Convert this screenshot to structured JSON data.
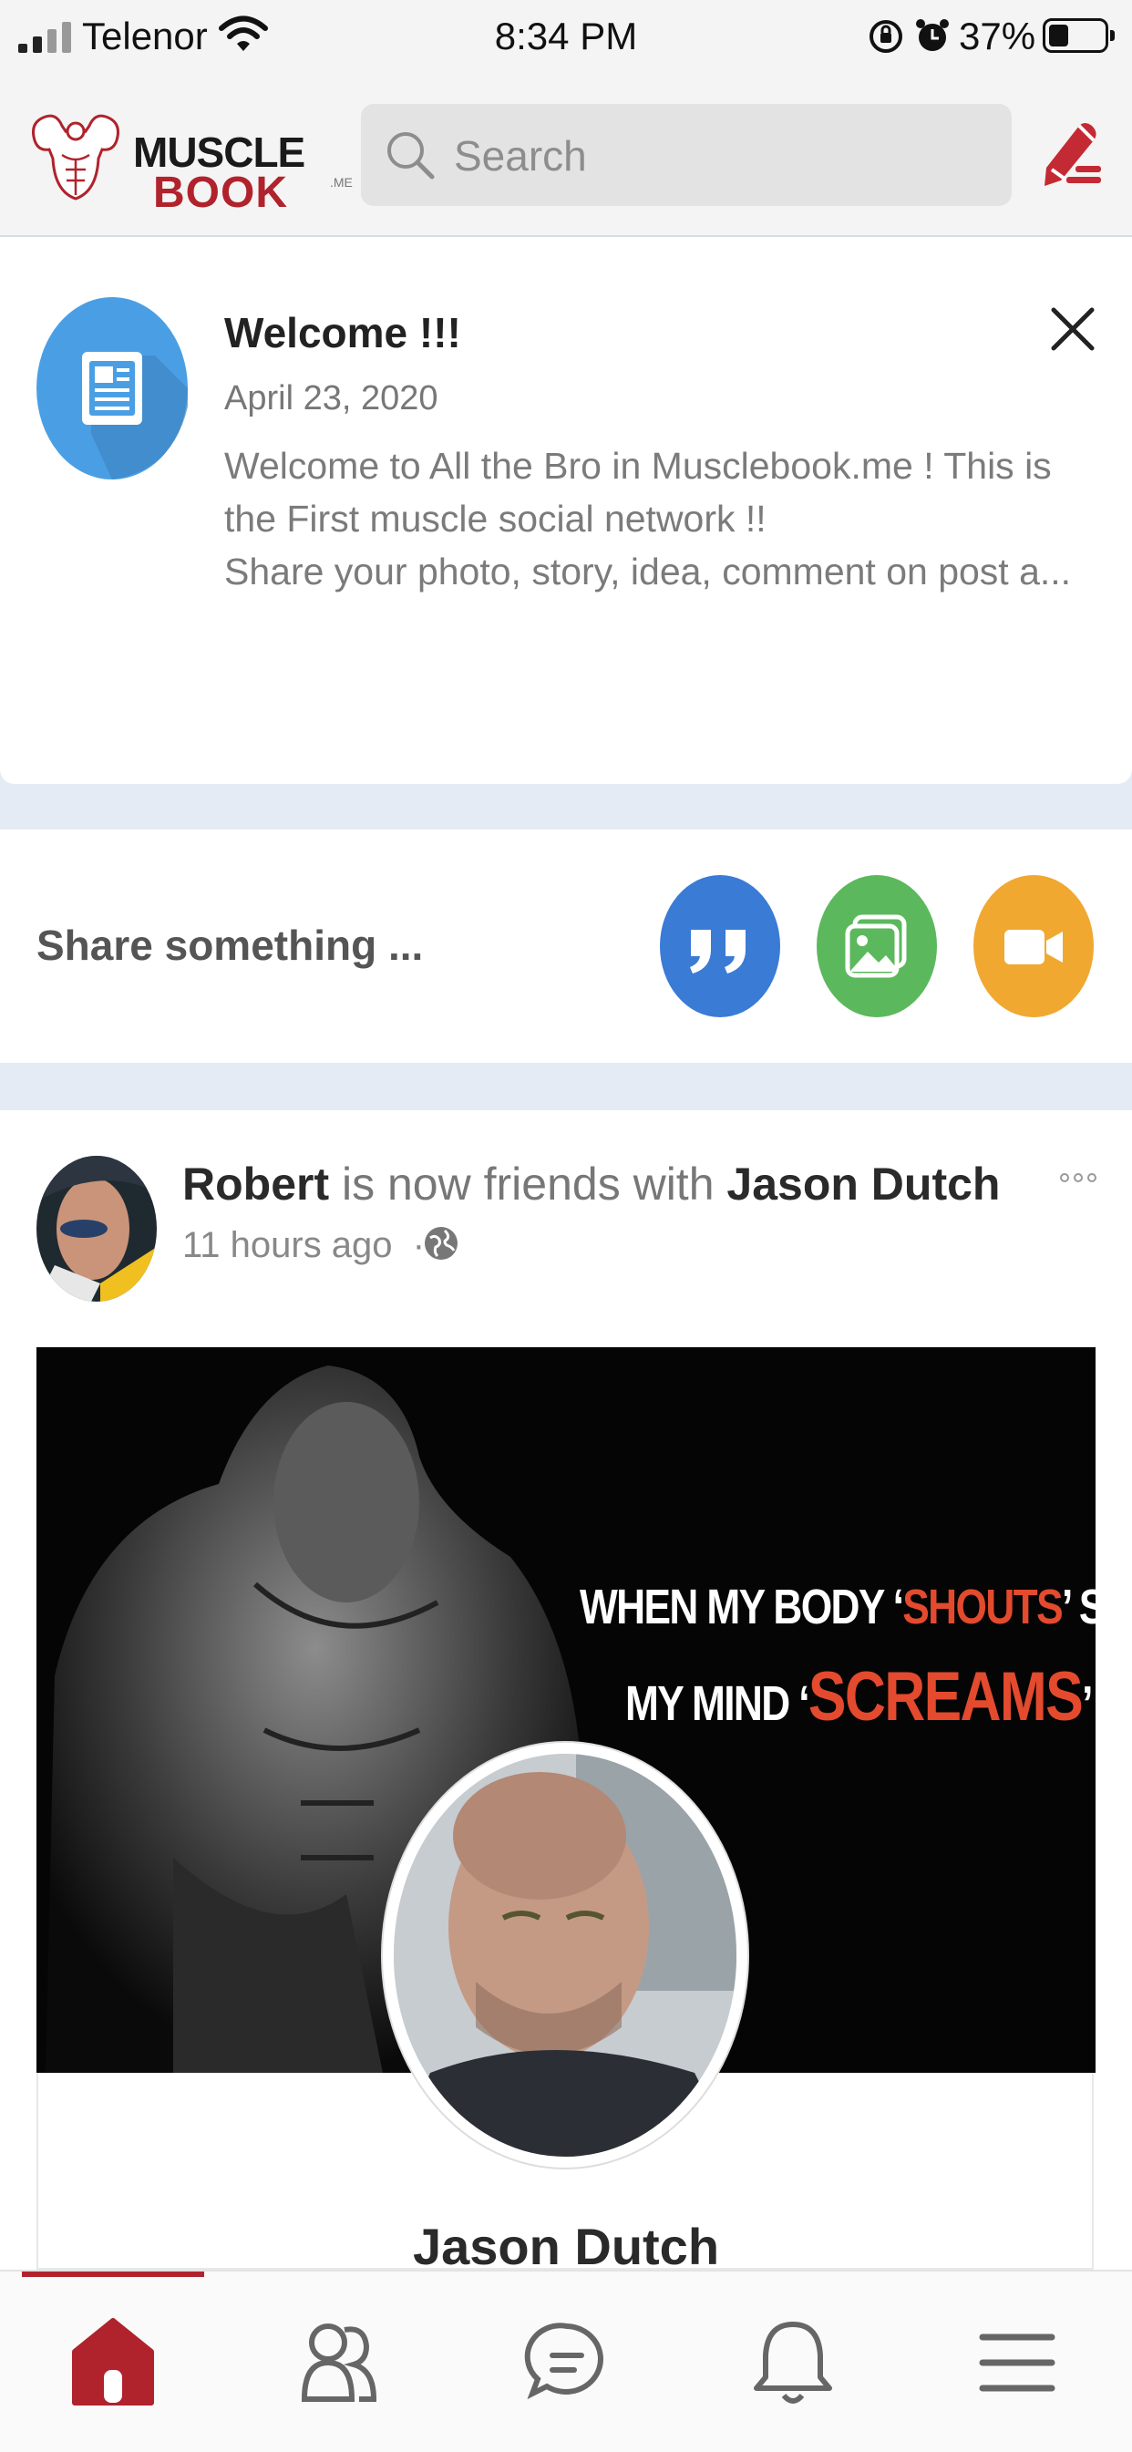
{
  "status_bar": {
    "carrier": "Telenor",
    "time": "8:34 PM",
    "battery_percent": "37%",
    "battery_level": 0.37
  },
  "header": {
    "logo_line1": "MUSCLE",
    "logo_line2": "BOOK",
    "logo_suffix": ".ME",
    "search_placeholder": "Search",
    "icons": [
      "search-icon",
      "compose-icon"
    ]
  },
  "welcome": {
    "title": "Welcome !!!",
    "date": "April 23, 2020",
    "lines": [
      "Welcome to All the Bro in Musclebook.me ! This is",
      "the First muscle social network !!",
      "Share your photo, story, idea, comment on post a..."
    ]
  },
  "share": {
    "prompt": "Share something ...",
    "buttons": [
      "quote-icon",
      "photo-icon",
      "video-icon"
    ]
  },
  "post": {
    "actor": "Robert",
    "verb": " is now friends with ",
    "target": "Jason Dutch",
    "time": "11 hours ago",
    "separator": "·",
    "cover_quote": {
      "l1_a": "WHEN MY BODY ‘",
      "l1_b": "SHOUTS",
      "l1_c": "’ STOP",
      "l2_a": "MY MIND ‘",
      "l2_b": "SCREAMS",
      "l2_c": "’ NEVER ."
    },
    "friend_name": "Jason Dutch"
  },
  "tabbar": {
    "items": [
      "home-icon",
      "friends-icon",
      "messages-icon",
      "notifications-icon",
      "menu-icon"
    ],
    "active": "home-icon"
  },
  "colors": {
    "brand_red": "#b0232d",
    "quote_blue": "#3a7bd5",
    "photo_green": "#5cb85c",
    "video_orange": "#f0a830"
  }
}
